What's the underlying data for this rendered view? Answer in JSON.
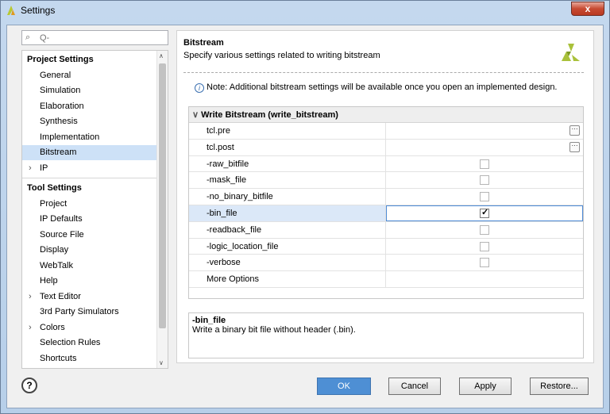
{
  "window": {
    "title": "Settings",
    "close_label": "x"
  },
  "search": {
    "placeholder": "Q-"
  },
  "tree": {
    "project_settings": "Project Settings",
    "project_items": [
      "General",
      "Simulation",
      "Elaboration",
      "Synthesis",
      "Implementation",
      "Bitstream"
    ],
    "ip": "IP",
    "tool_settings": "Tool Settings",
    "tool_items": [
      "Project",
      "IP Defaults",
      "Source File",
      "Display",
      "WebTalk",
      "Help",
      "Text Editor",
      "3rd Party Simulators",
      "Colors",
      "Selection Rules",
      "Shortcuts"
    ]
  },
  "page": {
    "title": "Bitstream",
    "subtitle": "Specify various settings related to writing bitstream",
    "note": "Note: Additional bitstream settings will be available once you open an implemented design."
  },
  "grid": {
    "header": "Write Bitstream (write_bitstream)",
    "rows": [
      {
        "name": "tcl.pre"
      },
      {
        "name": "tcl.post"
      },
      {
        "name": "-raw_bitfile"
      },
      {
        "name": "-mask_file"
      },
      {
        "name": "-no_binary_bitfile"
      },
      {
        "name": "-bin_file"
      },
      {
        "name": "-readback_file"
      },
      {
        "name": "-logic_location_file"
      },
      {
        "name": "-verbose"
      },
      {
        "name": "More Options"
      }
    ]
  },
  "description": {
    "title": "-bin_file",
    "text": "Write a binary bit file without header (.bin)."
  },
  "buttons": {
    "help": "?",
    "ok": "OK",
    "cancel": "Cancel",
    "apply": "Apply",
    "restore": "Restore..."
  },
  "colors": {
    "accent": "#4e8fd4",
    "selection": "#cde1f7",
    "logo": "#a9c13a"
  }
}
